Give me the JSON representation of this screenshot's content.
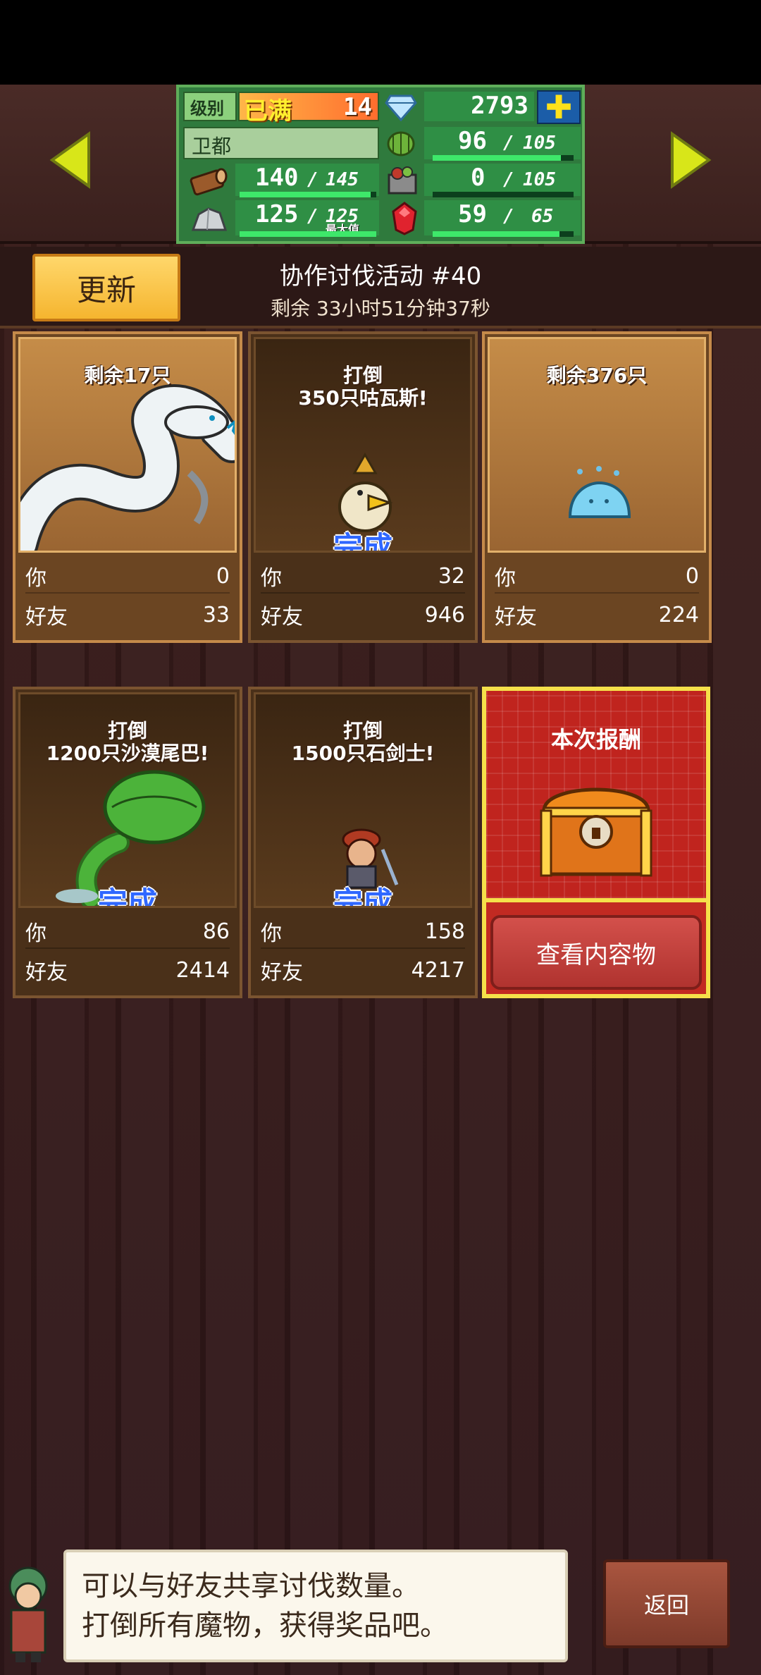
{
  "stats": {
    "level_label": "级别",
    "level_status": "已满",
    "level_value": "14",
    "gems": "2793",
    "town_name": "卫都",
    "grass": "96",
    "grass_max": "105",
    "grass_fraction": 0.91,
    "wood": "140",
    "wood_max": "145",
    "wood_fraction": 0.96,
    "food": "0",
    "food_max": "105",
    "food_fraction": 0,
    "ore": "125",
    "ore_max": "125",
    "ore_fraction": 1.0,
    "ore_note": "最大值",
    "ruby": "59",
    "ruby_max": "65",
    "ruby_fraction": 0.9
  },
  "header": {
    "update_label": "更新",
    "title": "协作讨伐活动 #40",
    "time_left": "剩余 33小时51分钟37秒"
  },
  "cards": [
    {
      "caption": "剩余17只",
      "done": "",
      "you_label": "你",
      "you": "0",
      "friend_label": "好友",
      "friend": "33"
    },
    {
      "caption": "打倒\n350只咕瓦斯!",
      "done": "完成",
      "you_label": "你",
      "you": "32",
      "friend_label": "好友",
      "friend": "946"
    },
    {
      "caption": "剩余376只",
      "done": "",
      "you_label": "你",
      "you": "0",
      "friend_label": "好友",
      "friend": "224"
    },
    {
      "caption": "打倒\n1200只沙漠尾巴!",
      "done": "完成",
      "you_label": "你",
      "you": "86",
      "friend_label": "好友",
      "friend": "2414"
    },
    {
      "caption": "打倒\n1500只石剑士!",
      "done": "完成",
      "you_label": "你",
      "you": "158",
      "friend_label": "好友",
      "friend": "4217"
    }
  ],
  "reward": {
    "title": "本次报酬",
    "view_label": "查看内容物"
  },
  "tip": {
    "line1": "可以与好友共享讨伐数量。",
    "line2": "打倒所有魔物，获得奖品吧。"
  },
  "return_label": "返回",
  "colors": {
    "accent": "#f5b52f",
    "done": "#2f67ff",
    "reward_bg": "#c22a22",
    "bar_fill": "#3ee86a"
  }
}
